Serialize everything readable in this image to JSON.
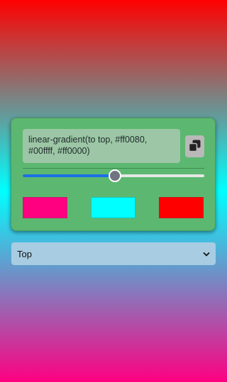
{
  "background": {
    "direction": "to top",
    "colors": [
      "#ff0080",
      "#00ffff",
      "#ff0000"
    ]
  },
  "generator": {
    "css_text": "linear-gradient(to top, #ff0080, #00ffff, #ff0000)",
    "copy_icon": "copy-icon",
    "slider_value_fraction": 0.5,
    "swatches": [
      {
        "color": "#ff0080"
      },
      {
        "color": "#00ffff"
      },
      {
        "color": "#ff0000"
      }
    ]
  },
  "direction_select": {
    "selected": "Top",
    "icon": "chevron-down-icon"
  }
}
